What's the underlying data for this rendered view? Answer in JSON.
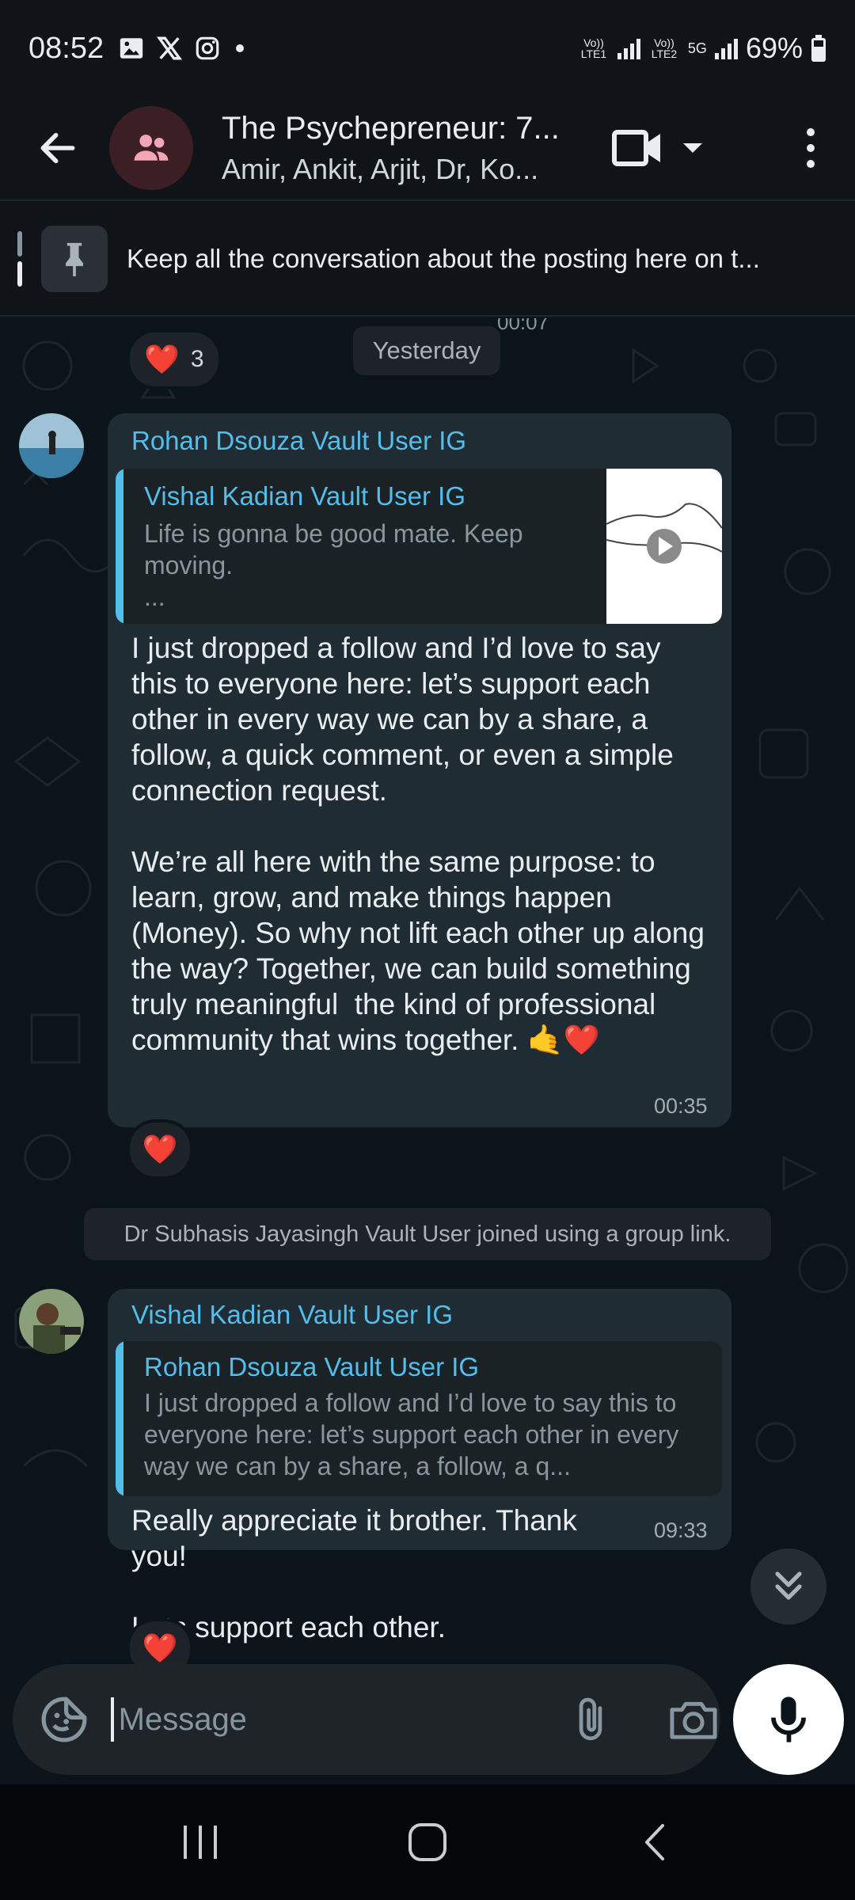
{
  "status_bar": {
    "time": "08:52",
    "sim1": "Vo)) LTE1",
    "sim2": "Vo)) LTE2",
    "network": "5G",
    "battery": "69%"
  },
  "header": {
    "title": "The Psychepreneur: 7...",
    "subtitle": "Amir, Ankit, Arjit, Dr, Ko..."
  },
  "pinned": {
    "text": "Keep all the conversation about the posting here on t..."
  },
  "chat": {
    "prev_time": "00:07",
    "date_label": "Yesterday",
    "prev_reaction": {
      "emoji": "❤️",
      "count": "3"
    },
    "messages": [
      {
        "sender": "Rohan Dsouza Vault User IG",
        "quote_sender": "Vishal Kadian Vault User IG",
        "quote_text": "Life is gonna be good mate. Keep moving.\n...",
        "text": "I just dropped a follow and I’d love to say this to everyone here: let’s support each other in every way we can by a share, a follow, a quick comment, or even a simple connection request.\n\nWe’re all here with the same purpose: to learn, grow, and make things happen (Money). So why not lift each other up along the way? Together, we can build something truly meaningful  the kind of professional community that wins together. 🤙❤️",
        "time": "00:35",
        "reaction": "❤️"
      },
      {
        "sender": "Vishal Kadian Vault User IG",
        "quote_sender": "Rohan Dsouza Vault User IG",
        "quote_text": "I just dropped a follow and I’d love to say this to everyone here: let’s support each other in every way we can by a share, a follow, a q...",
        "text": "Really appreciate it brother. Thank you!\n\nLets support each other.",
        "time": "09:33",
        "reaction": "❤️"
      }
    ],
    "system_message": "Dr Subhasis Jayasingh Vault User joined using a group link."
  },
  "input": {
    "placeholder": "Message"
  }
}
